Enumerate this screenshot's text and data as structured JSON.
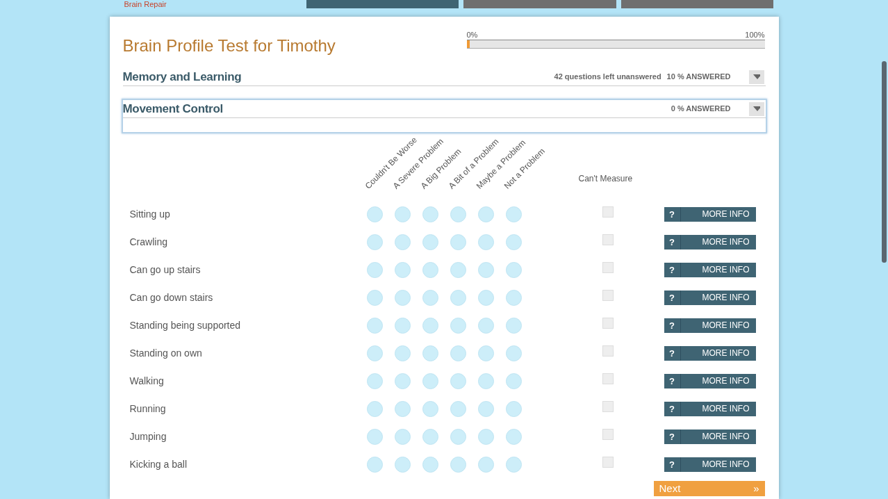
{
  "brand": {
    "text": "Brain Repair"
  },
  "nav_tabs": [
    {
      "selected": true
    },
    {
      "selected": false
    },
    {
      "selected": false
    }
  ],
  "title": "Brain Profile Test for Timothy",
  "progress": {
    "min_label": "0%",
    "max_label": "100%",
    "level": 0.01
  },
  "sections": [
    {
      "title": "Memory and Learning",
      "remaining": "42 questions left unanswered",
      "answered": "10 % ANSWERED",
      "selected": false
    },
    {
      "title": "Movement Control",
      "answered": "0 % ANSWERED",
      "selected": true
    }
  ],
  "scale": {
    "options": [
      "Couldn't Be Worse",
      "A Severe Problem",
      "A Big Problem",
      "A Bit of a Problem",
      "Maybe a Problem",
      "Not a Problem"
    ],
    "cant_measure": "Can't Measure"
  },
  "questions": [
    {
      "label": "Sitting up",
      "ratings": [
        false,
        false,
        false,
        false,
        false,
        false
      ],
      "cant_measure": false,
      "info_icon": "?",
      "info_label": "MORE INFO"
    },
    {
      "label": "Crawling",
      "ratings": [
        false,
        false,
        false,
        false,
        false,
        false
      ],
      "cant_measure": false,
      "info_icon": "?",
      "info_label": "MORE INFO"
    },
    {
      "label": "Can go up stairs",
      "ratings": [
        false,
        false,
        false,
        false,
        false,
        false
      ],
      "cant_measure": false,
      "info_icon": "?",
      "info_label": "MORE INFO"
    },
    {
      "label": "Can go down stairs",
      "ratings": [
        false,
        false,
        false,
        false,
        false,
        false
      ],
      "cant_measure": false,
      "info_icon": "?",
      "info_label": "MORE INFO"
    },
    {
      "label": "Standing being supported",
      "ratings": [
        false,
        false,
        false,
        false,
        false,
        false
      ],
      "cant_measure": false,
      "info_icon": "?",
      "info_label": "MORE INFO"
    },
    {
      "label": "Standing on own",
      "ratings": [
        false,
        false,
        false,
        false,
        false,
        false
      ],
      "cant_measure": false,
      "info_icon": "?",
      "info_label": "MORE INFO"
    },
    {
      "label": "Walking",
      "ratings": [
        false,
        false,
        false,
        false,
        false,
        false
      ],
      "cant_measure": false,
      "info_icon": "?",
      "info_label": "MORE INFO"
    },
    {
      "label": "Running",
      "ratings": [
        false,
        false,
        false,
        false,
        false,
        false
      ],
      "cant_measure": false,
      "info_icon": "?",
      "info_label": "MORE INFO"
    },
    {
      "label": "Jumping",
      "ratings": [
        false,
        false,
        false,
        false,
        false,
        false
      ],
      "cant_measure": false,
      "info_icon": "?",
      "info_label": "MORE INFO"
    },
    {
      "label": "Kicking a ball",
      "ratings": [
        false,
        false,
        false,
        false,
        false,
        false
      ],
      "cant_measure": false,
      "info_icon": "?",
      "info_label": "MORE INFO"
    }
  ],
  "next_button": {
    "label": "Next",
    "icon": "»"
  }
}
